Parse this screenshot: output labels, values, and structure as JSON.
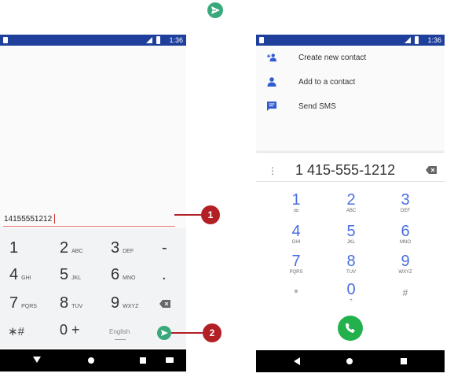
{
  "colors": {
    "status_bar": "#1e3f9c",
    "send_green": "#39a97c",
    "call_green": "#22b14c",
    "dialpad_blue": "#4a6ee0",
    "callout_red": "#b21f24",
    "keypad_bg": "#f1f3f4"
  },
  "icons": {
    "top_send": "send-icon",
    "contact_add": "person-add-icon",
    "contact": "person-icon",
    "sms": "message-icon",
    "backspace": "backspace-icon",
    "call": "phone-icon",
    "overflow": "more-vert-icon"
  },
  "left_phone": {
    "status_time": "1:36",
    "number_input": "14155551212",
    "keys": [
      {
        "num": "1",
        "letters": ""
      },
      {
        "num": "2",
        "letters": "ABC"
      },
      {
        "num": "3",
        "letters": "DEF"
      },
      {
        "num": "-",
        "letters": ""
      },
      {
        "num": "4",
        "letters": "GHI"
      },
      {
        "num": "5",
        "letters": "JKL"
      },
      {
        "num": "6",
        "letters": "MNO"
      },
      {
        "num": ".",
        "letters": ""
      },
      {
        "num": "7",
        "letters": "PQRS"
      },
      {
        "num": "8",
        "letters": "TUV"
      },
      {
        "num": "9",
        "letters": "WXYZ"
      }
    ],
    "symbols_key": "∗#",
    "zero_key": "0 +",
    "language": "English"
  },
  "right_phone": {
    "status_time": "1:36",
    "actions": [
      {
        "label": "Create new contact"
      },
      {
        "label": "Add to a contact"
      },
      {
        "label": "Send SMS"
      }
    ],
    "dialed_number": "1 415-555-1212",
    "dialpad": [
      {
        "digit": "1",
        "letters": "ꝏ"
      },
      {
        "digit": "2",
        "letters": "ABC"
      },
      {
        "digit": "3",
        "letters": "DEF"
      },
      {
        "digit": "4",
        "letters": "GHI"
      },
      {
        "digit": "5",
        "letters": "JKL"
      },
      {
        "digit": "6",
        "letters": "MNO"
      },
      {
        "digit": "7",
        "letters": "PQRS"
      },
      {
        "digit": "8",
        "letters": "TUV"
      },
      {
        "digit": "9",
        "letters": "WXYZ"
      },
      {
        "digit": "*",
        "letters": ""
      },
      {
        "digit": "0",
        "letters": "+"
      },
      {
        "digit": "#",
        "letters": ""
      }
    ]
  },
  "callouts": [
    "1",
    "2"
  ]
}
